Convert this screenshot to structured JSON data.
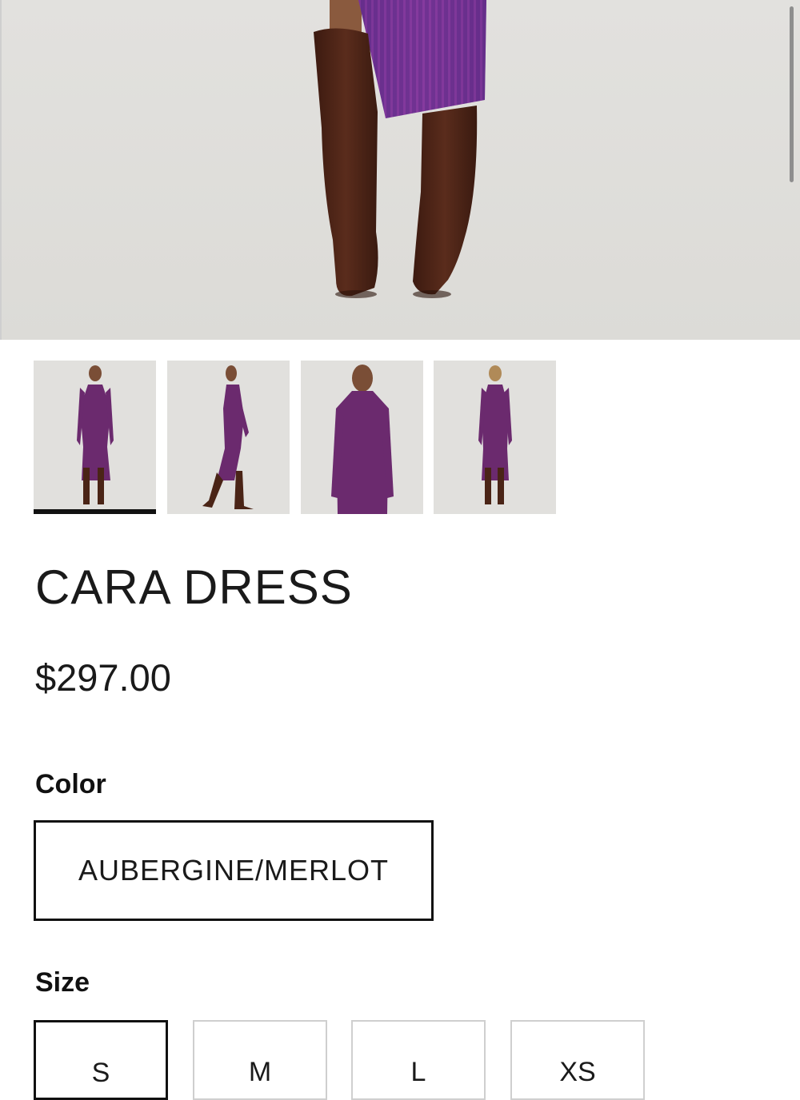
{
  "product": {
    "title": "CARA DRESS",
    "price": "$297.00"
  },
  "options": {
    "color_label": "Color",
    "color_value": "AUBERGINE/MERLOT",
    "size_label": "Size",
    "sizes": [
      "S",
      "M",
      "L",
      "XS"
    ],
    "selected_size": "S"
  },
  "gallery": {
    "thumbnail_count": 4,
    "active_index": 0
  },
  "colors": {
    "dress_purple": "#6b2a6e",
    "boot_brown": "#4a2416",
    "background": "#e1e0dd"
  }
}
